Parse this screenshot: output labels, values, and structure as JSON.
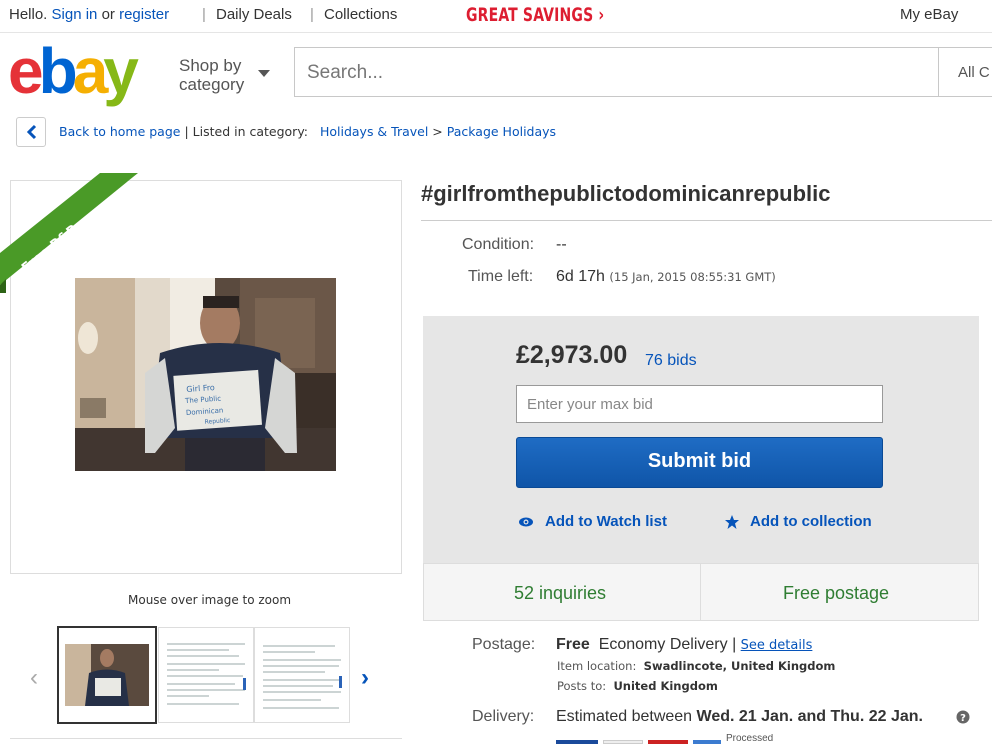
{
  "topbar": {
    "hello": "Hello.",
    "sign_in": "Sign in",
    "or": "or",
    "register": "register",
    "daily_deals": "Daily Deals",
    "collections": "Collections",
    "great_savings": "GREAT SAVINGS ›",
    "my_ebay": "My eBay"
  },
  "header": {
    "logo": "ebay",
    "shop_by_1": "Shop by",
    "shop_by_2": "category",
    "search_placeholder": "Search...",
    "all_categories": "All C"
  },
  "breadcrumb": {
    "back": "Back to home page",
    "listed": "| Listed in category:",
    "cat1": "Holidays & Travel",
    "sep": ">",
    "cat2": "Package Holidays"
  },
  "gallery": {
    "ribbon": "Free P&P",
    "zoom_hint": "Mouse over image to zoom",
    "sign_text": "Girl Fro The Public Dominican Republic"
  },
  "item": {
    "title": "#girlfromthepublictodominicanrepublic",
    "condition_label": "Condition:",
    "condition_value": "--",
    "time_left_label": "Time left:",
    "time_left_value": "6d 17h",
    "time_left_end": "(15 Jan, 2015   08:55:31 GMT)"
  },
  "bid": {
    "price": "£2,973.00",
    "bids": "76 bids",
    "max_bid_placeholder": "Enter your max bid",
    "submit": "Submit bid",
    "watch": "Add to Watch list",
    "collection": "Add to collection",
    "inquiries": "52 inquiries",
    "free_postage": "Free postage"
  },
  "postage": {
    "label": "Postage:",
    "free": "Free",
    "method": "Economy Delivery |",
    "see_details": "See details",
    "location_label": "Item location:",
    "location": "Swadlincote, United Kingdom",
    "posts_label": "Posts to:",
    "posts_to": "United Kingdom"
  },
  "delivery": {
    "label": "Delivery:",
    "estimated": "Estimated between",
    "dates": "Wed. 21 Jan. and Thu. 22 Jan.",
    "partial_text": "Processed"
  },
  "colors": {
    "link": "#0654ba",
    "red": "#dd1e31",
    "submit": "#1561b9",
    "green": "#2f7d32",
    "ribbon": "#4a9a27"
  }
}
